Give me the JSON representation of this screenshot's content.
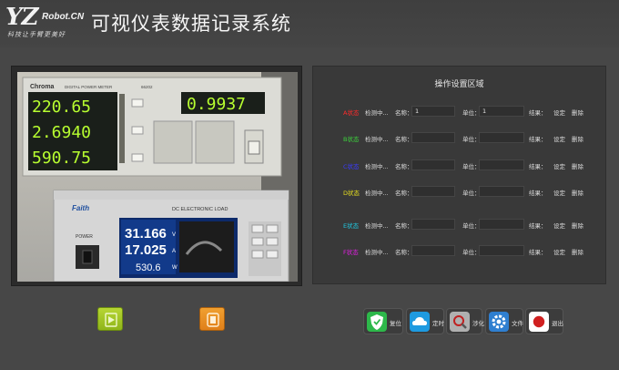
{
  "header": {
    "logo_main": "YZ",
    "logo_suffix": "Robot.CN",
    "logo_tagline": "科技让手臂更美好",
    "title": "可视仪表数据记录系统"
  },
  "camera": {
    "meter_brand": "Chroma",
    "meter_model_label": "DIGITAL POWER METER",
    "meter_model": "66202",
    "readings": [
      "220.65",
      "2.6940",
      "590.75"
    ],
    "pf_reading": "0.9937",
    "load_brand": "Faith",
    "load_label": "DC ELECTRONIC LOAD",
    "load_power_label": "POWER",
    "load_values": [
      "31.166",
      "17.025",
      "530.6"
    ],
    "load_units": [
      "V",
      "A",
      "W"
    ]
  },
  "settings": {
    "title": "操作设置区域",
    "rows": [
      {
        "state": "A状态",
        "state_color": "#ff2a2a",
        "detect": "检测中...",
        "name_label": "名称：",
        "name_value": "1",
        "unit_label": "单位：",
        "unit_value": "1",
        "result_label": "结果：",
        "set_label": "设定",
        "delete_label": "删除"
      },
      {
        "state": "B状态",
        "state_color": "#3cd23c",
        "detect": "检测中...",
        "name_label": "名称：",
        "name_value": "",
        "unit_label": "单位：",
        "unit_value": "",
        "result_label": "结果：",
        "set_label": "设定",
        "delete_label": "删除"
      },
      {
        "state": "C状态",
        "state_color": "#3a3aff",
        "detect": "检测中...",
        "name_label": "名称：",
        "name_value": "",
        "unit_label": "单位：",
        "unit_value": "",
        "result_label": "结果：",
        "set_label": "设定",
        "delete_label": "删除"
      },
      {
        "state": "D状态",
        "state_color": "#e8e020",
        "detect": "检测中...",
        "name_label": "名称：",
        "name_value": "",
        "unit_label": "单位：",
        "unit_value": "",
        "result_label": "结果：",
        "set_label": "设定",
        "delete_label": "删除"
      },
      {
        "state": "E状态",
        "state_color": "#20c8e0",
        "detect": "检测中...",
        "name_label": "名称：",
        "name_value": "",
        "unit_label": "单位：",
        "unit_value": "",
        "result_label": "结果：",
        "set_label": "设定",
        "delete_label": "删除"
      },
      {
        "state": "F状态",
        "state_color": "#e020e0",
        "detect": "检测中...",
        "name_label": "名称：",
        "name_value": "",
        "unit_label": "单位：",
        "unit_value": "",
        "result_label": "结果：",
        "set_label": "设定",
        "delete_label": "删除"
      }
    ]
  },
  "controls": {
    "start_icon": "play-icon",
    "stop_icon": "stop-icon"
  },
  "actions": [
    {
      "label": "复位",
      "icon": "shield-icon",
      "color": "#2db84a"
    },
    {
      "label": "定时",
      "icon": "cloud-icon",
      "color": "#1e9ae0"
    },
    {
      "label": "涉化",
      "icon": "magnifier-icon",
      "color": "#b0b0b0"
    },
    {
      "label": "文件",
      "icon": "gear-icon",
      "color": "#2f7fd0"
    },
    {
      "label": "退出",
      "icon": "power-icon",
      "color": "#d02020"
    }
  ]
}
